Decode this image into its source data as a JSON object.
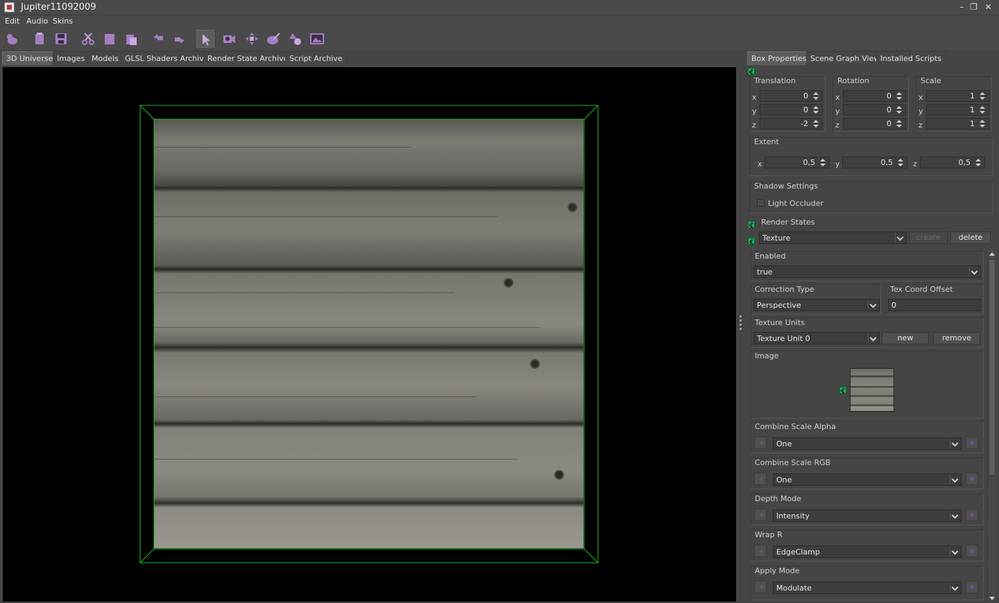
{
  "window": {
    "title": "Jupiter11092009"
  },
  "menu": [
    "Edit",
    "Audio",
    "Skins"
  ],
  "toolbar": [
    "duck-icon",
    "open-icon",
    "save-icon",
    "cut-icon",
    "copy-icon",
    "paste-icon",
    "undo-icon",
    "redo-icon",
    "select-icon",
    "camera-icon",
    "move-icon",
    "paint-icon",
    "shapes-icon",
    "picture-icon"
  ],
  "left_tabs": [
    "3D Universe",
    "Images",
    "Models",
    "GLSL Shaders Archive",
    "Render State Archive",
    "Script Archive"
  ],
  "right_tabs": [
    "Box Properties",
    "Scene Graph View",
    "Installed Scripts"
  ],
  "props": {
    "translation": {
      "label": "Translation",
      "x": "0",
      "y": "0",
      "z": "-2"
    },
    "rotation": {
      "label": "Rotation",
      "x": "0",
      "y": "0",
      "z": "0"
    },
    "scale": {
      "label": "Scale",
      "x": "1",
      "y": "1",
      "z": "1"
    },
    "axis": {
      "x": "x",
      "y": "y",
      "z": "z"
    },
    "extent": {
      "label": "Extent",
      "x": "0,5",
      "y": "0,5",
      "z": "0,5"
    },
    "shadow": {
      "label": "Shadow Settings",
      "light_occluder": "Light Occluder"
    },
    "render_states": {
      "label": "Render States",
      "selected": "Texture",
      "create": "create",
      "delete": "delete"
    }
  },
  "texture": {
    "enabled": {
      "label": "Enabled",
      "value": "true"
    },
    "correction": {
      "label": "Correction Type",
      "value": "Perspective"
    },
    "tex_offset": {
      "label": "Tex Coord Offset",
      "value": "0"
    },
    "units": {
      "label": "Texture Units",
      "value": "Texture Unit 0",
      "new": "new",
      "remove": "remove"
    },
    "image": {
      "label": "Image"
    },
    "combine_alpha": {
      "label": "Combine Scale Alpha",
      "value": "One"
    },
    "combine_rgb": {
      "label": "Combine Scale RGB",
      "value": "One"
    },
    "depth_mode": {
      "label": "Depth Mode",
      "value": "Intensity"
    },
    "wrap_r": {
      "label": "Wrap R",
      "value": "EdgeClamp"
    },
    "apply_mode": {
      "label": "Apply Mode",
      "value": "Modulate"
    }
  },
  "colors": {
    "accent": "#18b060",
    "bounding_box": "#1fc21f"
  }
}
